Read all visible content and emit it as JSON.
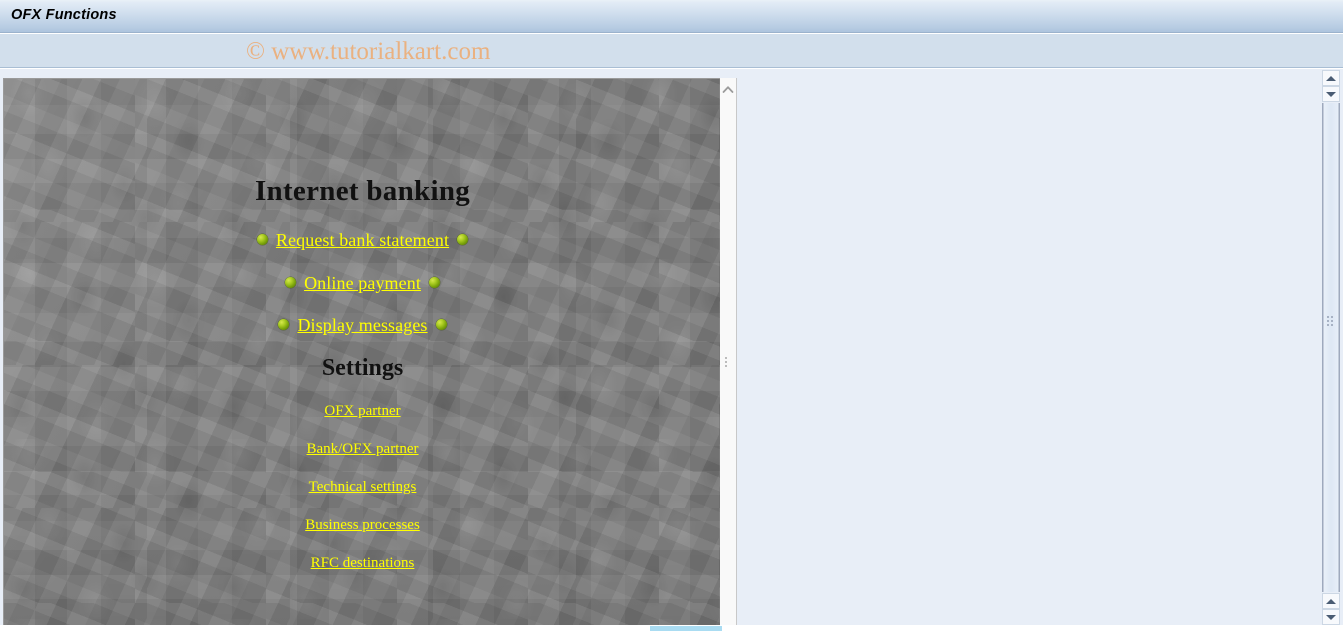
{
  "window": {
    "title": "OFX Functions"
  },
  "watermark": {
    "text": "© www.tutorialkart.com"
  },
  "content": {
    "heading": "Internet banking",
    "main_links": [
      {
        "label": "Request bank statement"
      },
      {
        "label": "Online payment"
      },
      {
        "label": "Display messages"
      }
    ],
    "settings_heading": "Settings",
    "settings_links": [
      {
        "label": "OFX partner"
      },
      {
        "label": "Bank/OFX partner"
      },
      {
        "label": "Technical settings"
      },
      {
        "label": "Business processes"
      },
      {
        "label": "RFC destinations"
      }
    ]
  },
  "icons": {
    "inner_scroll_up": "chevron-up-icon",
    "outer_scroll_up": "triangle-up-icon",
    "outer_scroll_down": "triangle-down-icon"
  },
  "colors": {
    "link": "#ffff00",
    "bullet": "#aacc22",
    "titlebar": "#b6cbe2",
    "watermark": "#eab180",
    "content_bg": "#7e7e7e",
    "pane_bg": "#e8eef7"
  }
}
